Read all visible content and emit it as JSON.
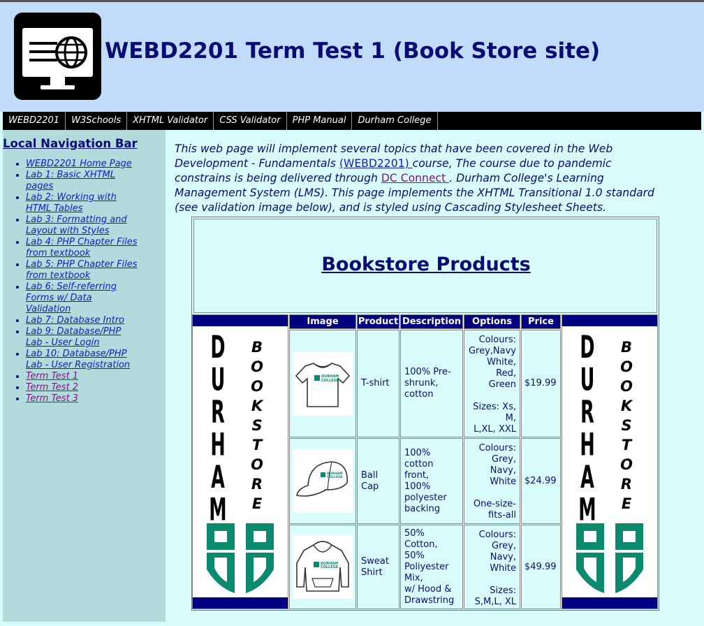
{
  "header": {
    "title": "WEBD2201 Term Test 1 (Book Store site)",
    "logo_icon": "monitor-globe-icon"
  },
  "topnav": {
    "items": [
      "WEBD2201",
      "W3Schools",
      "XHTML Validator",
      "CSS Validator",
      "PHP Manual",
      "Durham College"
    ]
  },
  "sidebar": {
    "title": "Local Navigation Bar",
    "items": [
      {
        "label": "WEBD2201 Home Page",
        "lines": [
          "WEBD2201 Home Page"
        ]
      },
      {
        "label": "Lab 1: Basic XHTML pages",
        "lines": [
          "Lab 1: Basic XHTML",
          "pages"
        ]
      },
      {
        "label": "Lab 2: Working with HTML Tables",
        "lines": [
          "Lab 2: Working with",
          "HTML Tables"
        ]
      },
      {
        "label": "Lab 3: Formatting and Layout with Styles",
        "lines": [
          "Lab 3: Formatting and",
          "Layout with Styles"
        ]
      },
      {
        "label": "Lab 4: PHP Chapter Files from textbook",
        "lines": [
          "Lab 4: PHP Chapter Files",
          "from textbook"
        ]
      },
      {
        "label": "Lab 5: PHP Chapter Files from textbook",
        "lines": [
          "Lab 5: PHP Chapter Files",
          "from textbook"
        ]
      },
      {
        "label": "Lab 6: Self-referring Forms w/ Data Validation",
        "lines": [
          "Lab 6: Self-referring",
          "Forms w/ Data",
          "Validation"
        ]
      },
      {
        "label": "Lab 7: Database Intro",
        "lines": [
          "Lab 7: Database Intro"
        ]
      },
      {
        "label": "Lab 9: Database/PHP Lab - User Login",
        "lines": [
          "Lab 9: Database/PHP",
          "Lab - User Login"
        ]
      },
      {
        "label": "Lab 10: Database/PHP Lab - User Registration",
        "lines": [
          "Lab 10: Database/PHP",
          "Lab - User Registration"
        ]
      },
      {
        "label": "Term Test 1",
        "lines": [
          "Term Test 1"
        ],
        "visited": true
      },
      {
        "label": "Term Test 2",
        "lines": [
          "Term Test 2"
        ],
        "visited": true
      },
      {
        "label": "Term Test 3",
        "lines": [
          "Term Test 3"
        ],
        "visited": true
      }
    ]
  },
  "intro": {
    "line1": "This web page will implement several topics that have been covered in the Web",
    "line2_before": "Development - Fundamentals ",
    "link1": "(WEBD2201) ",
    "line2_after": "course, The course due to pandemic",
    "line3_before": "constrains is being delivered through ",
    "link2": "DC Connect ",
    "line3_after": ". Durham College's Learning",
    "line4": "Management System (LMS). This page implements the XHTML Transitional 1.0 standard",
    "line5": "(see validation image below), and is styled using Cascading Stylesheet Sheets."
  },
  "bookstore": {
    "heading": "Bookstore Products",
    "headers": [
      "Image",
      "Product",
      "Description",
      "Options",
      "Price"
    ],
    "banner": {
      "left_letters": [
        "D",
        "U",
        "R",
        "H",
        "A",
        "M"
      ],
      "right_letters": [
        "B",
        "O",
        "O",
        "K",
        "S",
        "T",
        "O",
        "R",
        "E"
      ],
      "logo_icon": "durham-college-crest-icon"
    },
    "rows": [
      {
        "image_icon": "tshirt-icon",
        "product": [
          "T-shirt"
        ],
        "description": [
          "100% Pre-",
          "shrunk,",
          "cotton"
        ],
        "options": [
          "Colours:",
          "Grey,Navy",
          "White,",
          "Red,",
          "Green",
          "",
          "Sizes: Xs,",
          "M,",
          "L,XL, XXL"
        ],
        "price": "$19.99"
      },
      {
        "image_icon": "ball-cap-icon",
        "product": [
          "Ball",
          "Cap"
        ],
        "description": [
          "100%",
          "cotton",
          "front,",
          "100%",
          "polyester",
          "backing"
        ],
        "options": [
          "Colours:",
          "Grey,",
          "Navy,",
          "White",
          "",
          "One-size-",
          "fits-all"
        ],
        "price": "$24.99"
      },
      {
        "image_icon": "hoodie-icon",
        "product": [
          "Sweat",
          "Shirt"
        ],
        "description": [
          "50%",
          "Cotton,",
          "50%",
          "Poliyester",
          "Mix,",
          "w/ Hood &",
          "Drawstring"
        ],
        "options": [
          "Colours:",
          "Grey,",
          "Navy,",
          "White",
          "",
          "Sizes:",
          "S,M,L, XL"
        ],
        "price": "$49.99"
      }
    ]
  },
  "colors": {
    "header_bg": "#c1dcfb",
    "sidebar_bg": "#b2dcdb",
    "content_bg": "#d8fbfb",
    "navy": "#000080",
    "title_text": "#0b0b75",
    "durham_green": "#0a8a6e"
  }
}
